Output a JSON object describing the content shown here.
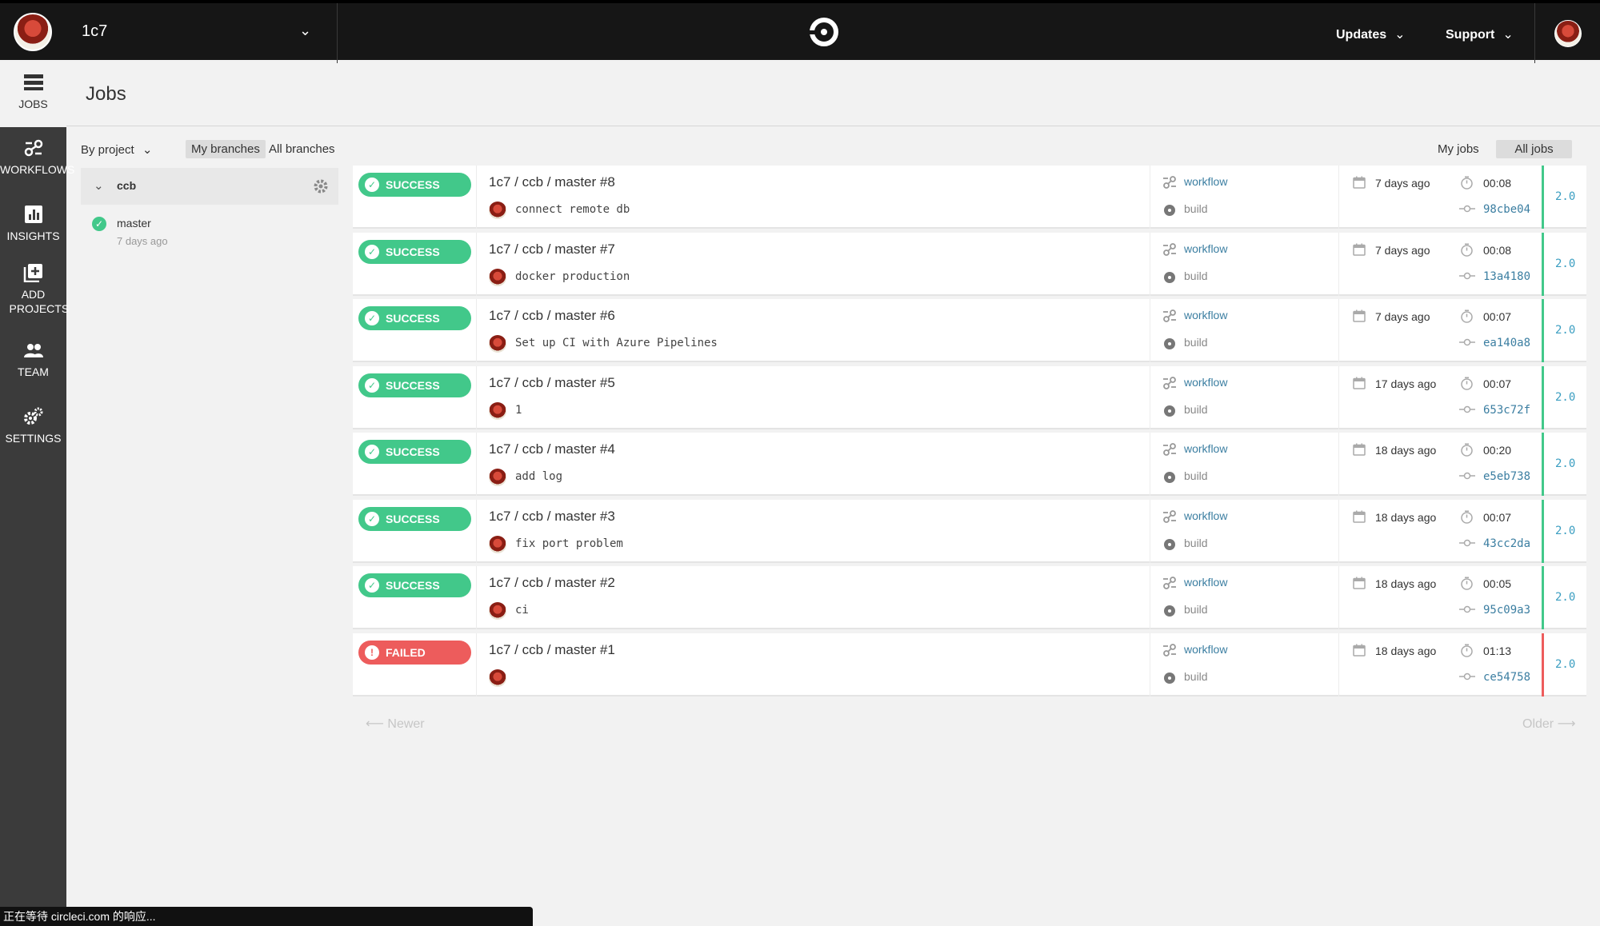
{
  "topbar": {
    "org_name": "1c7",
    "updates_label": "Updates",
    "support_label": "Support"
  },
  "nav": {
    "items": [
      {
        "label": "JOBS",
        "icon": "jobs-icon"
      },
      {
        "label": "WORKFLOWS",
        "icon": "workflows-icon"
      },
      {
        "label": "INSIGHTS",
        "icon": "insights-icon"
      },
      {
        "label": "ADD PROJECTS",
        "icon": "add-projects-icon"
      },
      {
        "label": "TEAM",
        "icon": "team-icon"
      },
      {
        "label": "SETTINGS",
        "icon": "settings-icon"
      }
    ]
  },
  "page": {
    "title": "Jobs"
  },
  "filters": {
    "by_project": "By project",
    "my_branches": "My branches",
    "all_branches": "All branches",
    "my_jobs": "My jobs",
    "all_jobs": "All jobs"
  },
  "project": {
    "name": "ccb",
    "branch": "master",
    "branch_time": "7 days ago"
  },
  "colors": {
    "success": "#42c88a",
    "failed": "#ed5c5c",
    "link": "#3b7ea1",
    "topbar": "#161616",
    "sidebar": "#3b3b3b"
  },
  "jobs": [
    {
      "status": "SUCCESS",
      "title": "1c7 / ccb / master #8",
      "message": "connect remote db",
      "workflow": "workflow",
      "job": "build",
      "when": "7 days ago",
      "duration": "00:08",
      "sha": "98cbe04",
      "version": "2.0"
    },
    {
      "status": "SUCCESS",
      "title": "1c7 / ccb / master #7",
      "message": "docker production",
      "workflow": "workflow",
      "job": "build",
      "when": "7 days ago",
      "duration": "00:08",
      "sha": "13a4180",
      "version": "2.0"
    },
    {
      "status": "SUCCESS",
      "title": "1c7 / ccb / master #6",
      "message": "Set up CI with Azure Pipelines",
      "workflow": "workflow",
      "job": "build",
      "when": "7 days ago",
      "duration": "00:07",
      "sha": "ea140a8",
      "version": "2.0"
    },
    {
      "status": "SUCCESS",
      "title": "1c7 / ccb / master #5",
      "message": "1",
      "workflow": "workflow",
      "job": "build",
      "when": "17 days ago",
      "duration": "00:07",
      "sha": "653c72f",
      "version": "2.0"
    },
    {
      "status": "SUCCESS",
      "title": "1c7 / ccb / master #4",
      "message": "add log",
      "workflow": "workflow",
      "job": "build",
      "when": "18 days ago",
      "duration": "00:20",
      "sha": "e5eb738",
      "version": "2.0"
    },
    {
      "status": "SUCCESS",
      "title": "1c7 / ccb / master #3",
      "message": "fix port problem",
      "workflow": "workflow",
      "job": "build",
      "when": "18 days ago",
      "duration": "00:07",
      "sha": "43cc2da",
      "version": "2.0"
    },
    {
      "status": "SUCCESS",
      "title": "1c7 / ccb / master #2",
      "message": "ci",
      "workflow": "workflow",
      "job": "build",
      "when": "18 days ago",
      "duration": "00:05",
      "sha": "95c09a3",
      "version": "2.0"
    },
    {
      "status": "FAILED",
      "title": "1c7 / ccb / master #1",
      "message": "",
      "workflow": "workflow",
      "job": "build",
      "when": "18 days ago",
      "duration": "01:13",
      "sha": "ce54758",
      "version": "2.0"
    }
  ],
  "pager": {
    "newer": "⟵ Newer",
    "older": "Older ⟶"
  },
  "statusbar": {
    "text": "正在等待 circleci.com 的响应..."
  }
}
